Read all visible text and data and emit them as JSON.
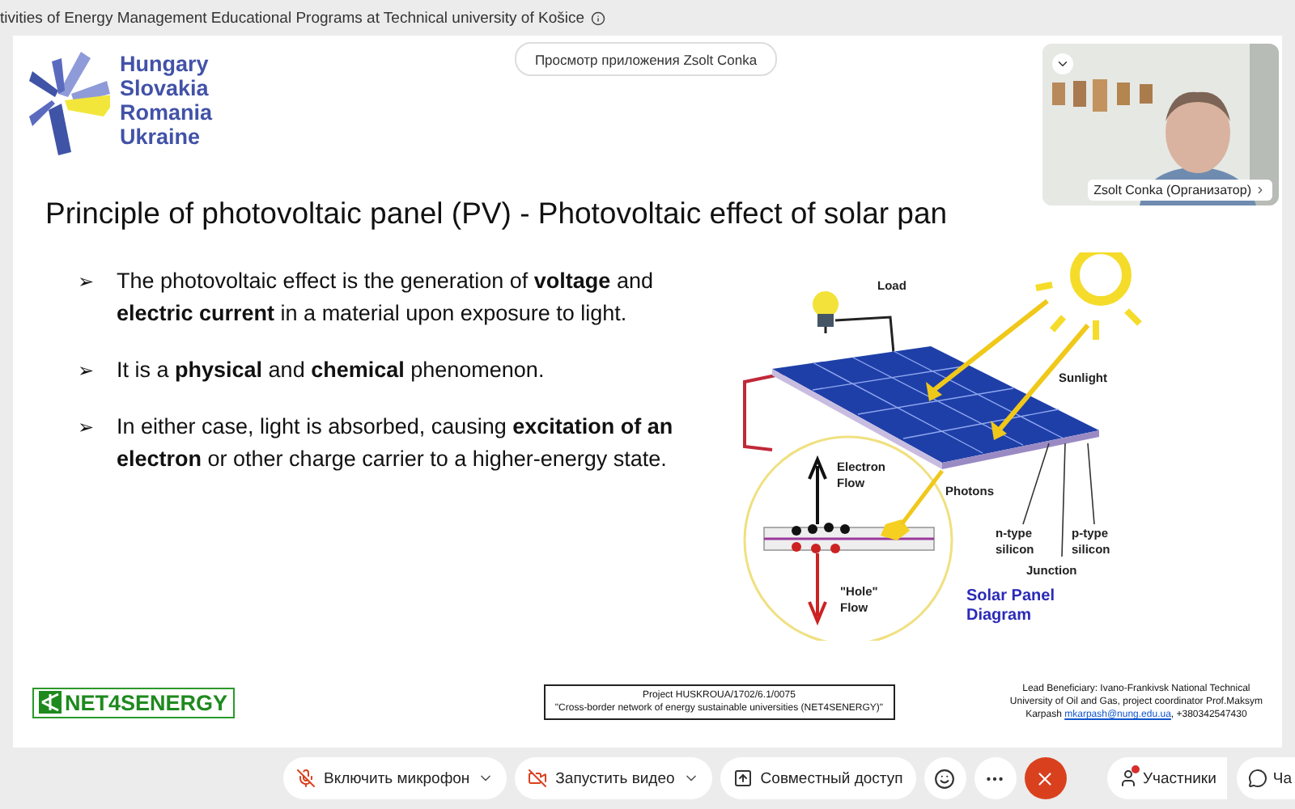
{
  "meeting_title": "tivities of Energy Management Educational Programs at Technical university of Košice",
  "share_banner": "Просмотр приложения Zsolt Conka",
  "video": {
    "name": "Zsolt Conka (Организатор)"
  },
  "slide": {
    "logo_lines": [
      "Hungary",
      "Slovakia",
      "Romania",
      "Ukraine"
    ],
    "title": "Principle of photovoltaic panel (PV) -  Photovoltaic effect of solar pan",
    "bullets": [
      {
        "marker": "➢",
        "text": "The photovoltaic effect is the generation of **voltage** and **electric current** in a material upon exposure to light."
      },
      {
        "marker": "➢",
        "text": "It is a **physical** and **chemical** phenomenon."
      },
      {
        "marker": "➢",
        "text": "In either case, light is absorbed, causing **excitation of an electron** or other charge carrier to a higher-energy state."
      }
    ],
    "diagram_labels": [
      {
        "kind": "label",
        "lines": [
          "Load"
        ]
      },
      {
        "kind": "label",
        "lines": [
          "Sunlight"
        ]
      },
      {
        "kind": "label",
        "lines": [
          "Electron",
          "Flow"
        ]
      },
      {
        "kind": "label",
        "lines": [
          "Photons"
        ]
      },
      {
        "kind": "label",
        "lines": [
          "n-type",
          "silicon"
        ]
      },
      {
        "kind": "label",
        "lines": [
          "p-type",
          "silicon"
        ]
      },
      {
        "kind": "label",
        "lines": [
          "Junction"
        ]
      },
      {
        "kind": "label",
        "lines": [
          "\"Hole\"",
          "Flow"
        ]
      },
      {
        "kind": "caption",
        "lines": [
          "Solar Panel",
          "Diagram"
        ]
      }
    ],
    "footer": {
      "brand": "NET4SENERGY",
      "project": [
        "Project HUSKROUA/1702/6.1/0075",
        "\"Cross-border network of energy sustainable universities  (NET4SENERGY)\""
      ],
      "beneficiary": {
        "lines": [
          "Lead Beneficiary: Ivano-Frankivsk National Technical",
          "University of Oil and Gas, project coordinator Prof.Maksym"
        ],
        "last_prefix": "Karpash",
        "email": "mkarpash@nung.edu.ua",
        "suffix": ", +380342547430"
      }
    }
  },
  "toolbar": [
    {
      "kind": "mic",
      "label": "Включить микрофон",
      "dropdown": true
    },
    {
      "kind": "video",
      "label": "Запустить видео",
      "dropdown": true
    },
    {
      "kind": "share",
      "label": "Совместный доступ",
      "dropdown": false
    },
    {
      "kind": "reactions"
    },
    {
      "kind": "more"
    },
    {
      "kind": "end"
    }
  ],
  "side_buttons": [
    {
      "kind": "participants",
      "label": "Участники",
      "alert": true
    },
    {
      "kind": "chat",
      "label": "Ча",
      "alert": false
    }
  ]
}
